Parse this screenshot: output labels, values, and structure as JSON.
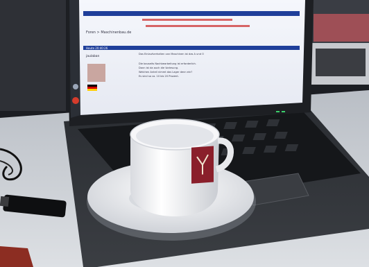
{
  "scene": {
    "description_objects": [
      "laptop",
      "espresso-cup",
      "saucer",
      "usb-stick",
      "desk"
    ],
    "colors": {
      "screen_bg": "#f2f4fa",
      "screen_header": "#1f3f9a",
      "laptop_body": "#2b2e33",
      "keyboard": "#1c1e22",
      "cup": "#f3f3f5",
      "logo": "#8a1f2b",
      "desk": "#cfd3d8"
    }
  },
  "screen": {
    "breadcrumb": "Foren > Maschinenbau.de",
    "user_name": "jaulaban",
    "timestamp": "Heute 20:40:26",
    "post_line_1": "Das Einlaufverhalten von Maschinen ist das A und O",
    "post_line_2": "Die bauseits Nachbearbeitung ist erforderlich.",
    "post_line_3": "Dann ist da auch die Vorlesung.",
    "post_line_4": "Welchen Anteil nimmt das Lager denn ein?",
    "post_line_5": "Es sind so ca. 10 bis 20 Prozent."
  }
}
